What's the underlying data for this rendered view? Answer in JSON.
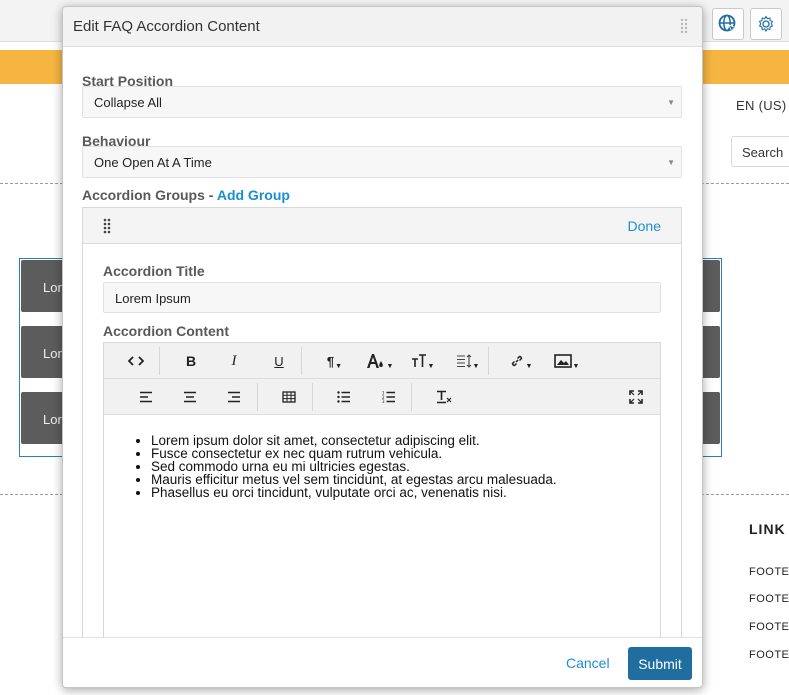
{
  "background": {
    "language": "EN (US)",
    "search_label": "Search",
    "accordion_items": [
      "Lor",
      "Lor",
      "Lor"
    ],
    "links_title": "LINK",
    "footer_links": [
      "FOOTEI",
      "FOOTEI",
      "FOOTEI",
      "FOOTEI"
    ],
    "accent_color": "#f6b541",
    "icons": [
      "globe-cursor-icon",
      "gear-icon"
    ]
  },
  "modal": {
    "title": "Edit FAQ Accordion Content",
    "start_position": {
      "label": "Start Position",
      "value": "Collapse All"
    },
    "behaviour": {
      "label": "Behaviour",
      "value": "One Open At A Time"
    },
    "groups": {
      "label": "Accordion Groups - ",
      "add_label": "Add Group",
      "done_label": "Done",
      "title_label": "Accordion Title",
      "title_value": "Lorem Ipsum",
      "content_label": "Accordion Content"
    },
    "editor": {
      "toolbar_row1": [
        "code-view-icon",
        "bold-icon",
        "italic-icon",
        "underline-icon",
        "paragraph-format-icon",
        "text-color-icon",
        "font-size-icon",
        "line-height-icon",
        "insert-link-icon",
        "insert-image-icon"
      ],
      "toolbar_row2": [
        "align-left-icon",
        "align-center-icon",
        "align-right-icon",
        "insert-table-icon",
        "unordered-list-icon",
        "ordered-list-icon",
        "clear-formatting-icon",
        "fullscreen-icon"
      ],
      "bullets": [
        "Lorem ipsum dolor sit amet, consectetur adipiscing elit.",
        "Fusce consectetur ex nec quam rutrum vehicula.",
        "Sed commodo urna eu mi ultricies egestas.",
        "Mauris efficitur metus vel sem tincidunt, at egestas arcu malesuada.",
        "Phasellus eu orci tincidunt, vulputate orci ac, venenatis nisi."
      ]
    },
    "footer": {
      "cancel_label": "Cancel",
      "submit_label": "Submit"
    },
    "link_color": "#1a8fd0",
    "submit_color": "#1f6e9f"
  }
}
